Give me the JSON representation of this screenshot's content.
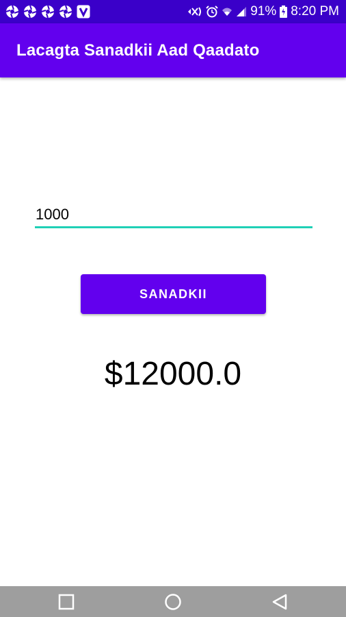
{
  "status_bar": {
    "notification_icons": [
      "pinwheel-icon",
      "pinwheel-icon",
      "pinwheel-icon",
      "pinwheel-icon",
      "v-app-icon"
    ],
    "battery_percent": "91%",
    "time": "8:20 PM"
  },
  "app_bar": {
    "title": "Lacagta Sanadkii Aad Qaadato"
  },
  "main": {
    "amount_input_value": "1000",
    "calculate_button_label": "SANADKII",
    "result_text": "$12000.0"
  },
  "nav_bar": {
    "icons": [
      "recent-apps-icon",
      "home-icon",
      "back-icon"
    ]
  },
  "colors": {
    "primary": "#6200ee",
    "status_bar": "#3a00c9",
    "accent": "#1fd0b6",
    "nav_bar": "#9e9e9e"
  }
}
